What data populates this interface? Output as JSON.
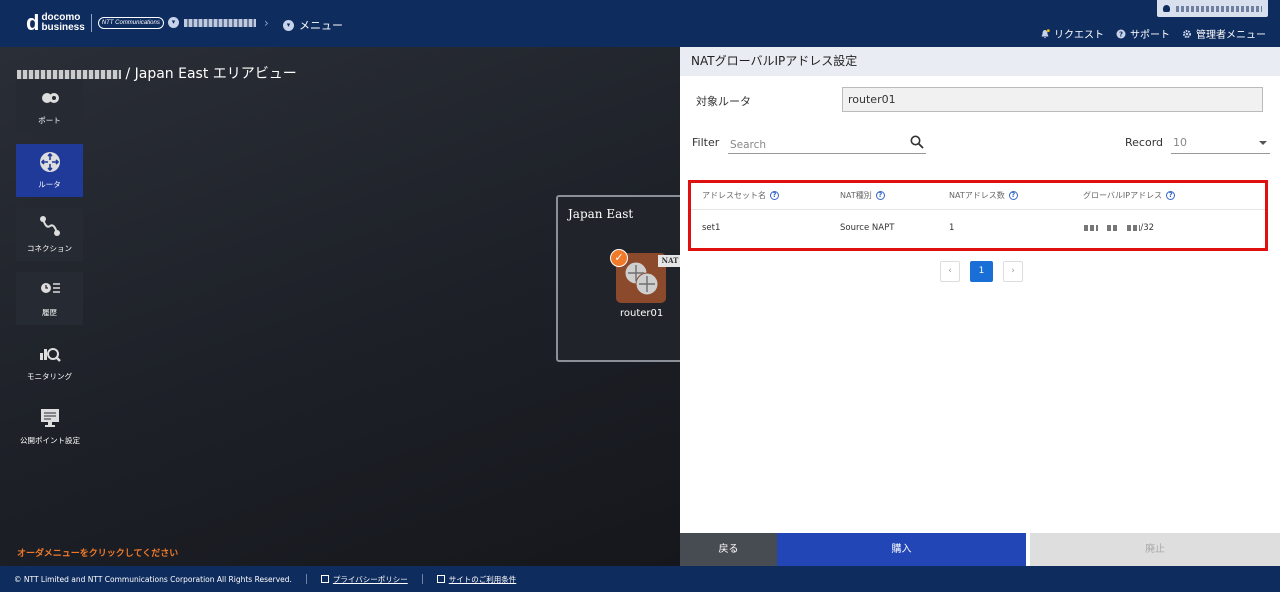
{
  "header": {
    "logo_mark": "d",
    "logo_line1": "docomo",
    "logo_line2": "business",
    "logo_ntt": "NTT Communications",
    "menu_label": "メニュー",
    "links": {
      "request": "リクエスト",
      "support": "サポート",
      "admin_menu": "管理者メニュー"
    }
  },
  "page": {
    "title": "/ Japan East エリアビュー"
  },
  "sidebar": {
    "items": [
      {
        "label": "ポート",
        "icon": "port-icon"
      },
      {
        "label": "ルータ",
        "icon": "router-icon",
        "active": true
      },
      {
        "label": "コネクション",
        "icon": "connection-icon"
      },
      {
        "label": "履歴",
        "icon": "history-icon"
      },
      {
        "label": "モニタリング",
        "icon": "monitoring-icon"
      },
      {
        "label": "公開ポイント設定",
        "icon": "public-point-icon"
      }
    ]
  },
  "area": {
    "label": "Japan East",
    "router_name": "router01",
    "nat_badge": "NAT"
  },
  "order_hint": "オーダメニューをクリックしてください",
  "panel": {
    "title": "NATグローバルIPアドレス設定",
    "target_router_label": "対象ルータ",
    "target_router_value": "router01",
    "filter_label": "Filter",
    "search_placeholder": "Search",
    "record_label": "Record",
    "record_value": "10",
    "table": {
      "headers": [
        "アドレスセット名",
        "NAT種別",
        "NATアドレス数",
        "グローバルIPアドレス"
      ],
      "rows": [
        {
          "name": "set1",
          "type": "Source NAPT",
          "count": "1",
          "ip_suffix": "/32"
        }
      ]
    },
    "pager": {
      "prev": "‹",
      "current": "1",
      "next": "›"
    },
    "buttons": {
      "back": "戻る",
      "buy": "購入",
      "abolish": "廃止"
    }
  },
  "footer": {
    "copyright": "© NTT Limited and NTT Communications Corporation All Rights Reserved.",
    "privacy": "プライバシーポリシー",
    "terms": "サイトのご利用条件"
  },
  "colors": {
    "header_bg": "#0f2c5e",
    "active_side": "#203a9a",
    "highlight_border": "#e01010",
    "buy_button": "#2246b6",
    "orange": "#f07a2a"
  }
}
